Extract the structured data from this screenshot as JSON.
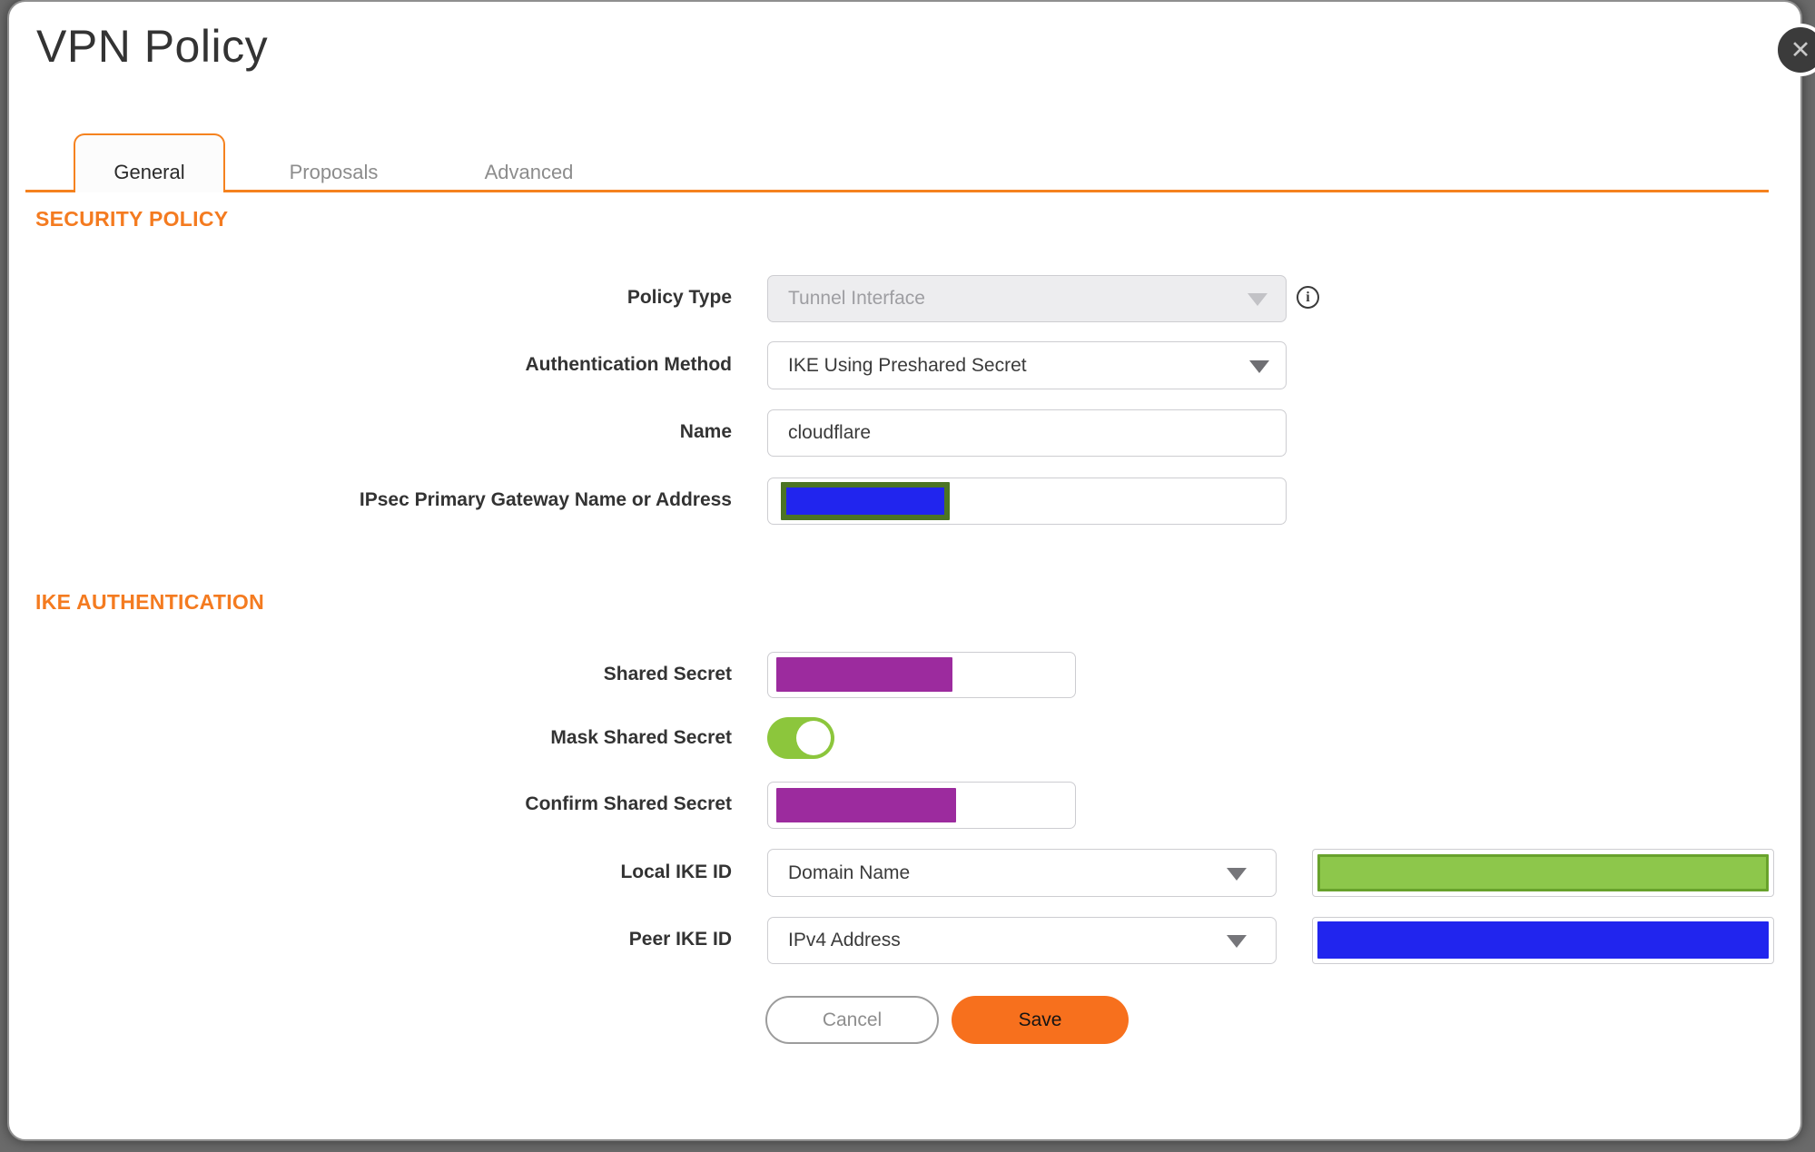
{
  "dialog": {
    "title": "VPN Policy",
    "close_icon": "✕"
  },
  "tabs": [
    {
      "label": "General",
      "active": true
    },
    {
      "label": "Proposals",
      "active": false
    },
    {
      "label": "Advanced",
      "active": false
    }
  ],
  "sections": {
    "security_policy": "SECURITY POLICY",
    "ike_authentication": "IKE AUTHENTICATION"
  },
  "form": {
    "policy_type": {
      "label": "Policy Type",
      "value": "Tunnel Interface",
      "disabled": true,
      "info_icon": "i"
    },
    "authentication_method": {
      "label": "Authentication Method",
      "value": "IKE Using Preshared Secret"
    },
    "name": {
      "label": "Name",
      "value": "cloudflare"
    },
    "gateway": {
      "label": "IPsec Primary Gateway Name or Address",
      "value": "",
      "redacted": true
    },
    "shared_secret": {
      "label": "Shared Secret",
      "value": "",
      "redacted": true
    },
    "mask_shared_secret": {
      "label": "Mask Shared Secret",
      "enabled": true
    },
    "confirm_shared_secret": {
      "label": "Confirm Shared Secret",
      "value": "",
      "redacted": true
    },
    "local_ike_id": {
      "label": "Local IKE ID",
      "type_value": "Domain Name",
      "value": "",
      "redacted": true
    },
    "peer_ike_id": {
      "label": "Peer IKE ID",
      "type_value": "IPv4 Address",
      "value": "",
      "redacted": true
    }
  },
  "buttons": {
    "cancel": "Cancel",
    "save": "Save"
  },
  "colors": {
    "accent_orange": "#F5821F",
    "heading_orange": "#F47B20",
    "save_orange": "#F7701D",
    "toggle_green": "#8CC63C",
    "redaction_purple": "#9C2B9E",
    "redaction_blue": "#2125EE",
    "gateway_redaction_border": "#4C7424",
    "ike_green_fill": "#8DC74B",
    "ike_green_border": "#68A22C",
    "backdrop_gray": "#6A6A6A"
  }
}
